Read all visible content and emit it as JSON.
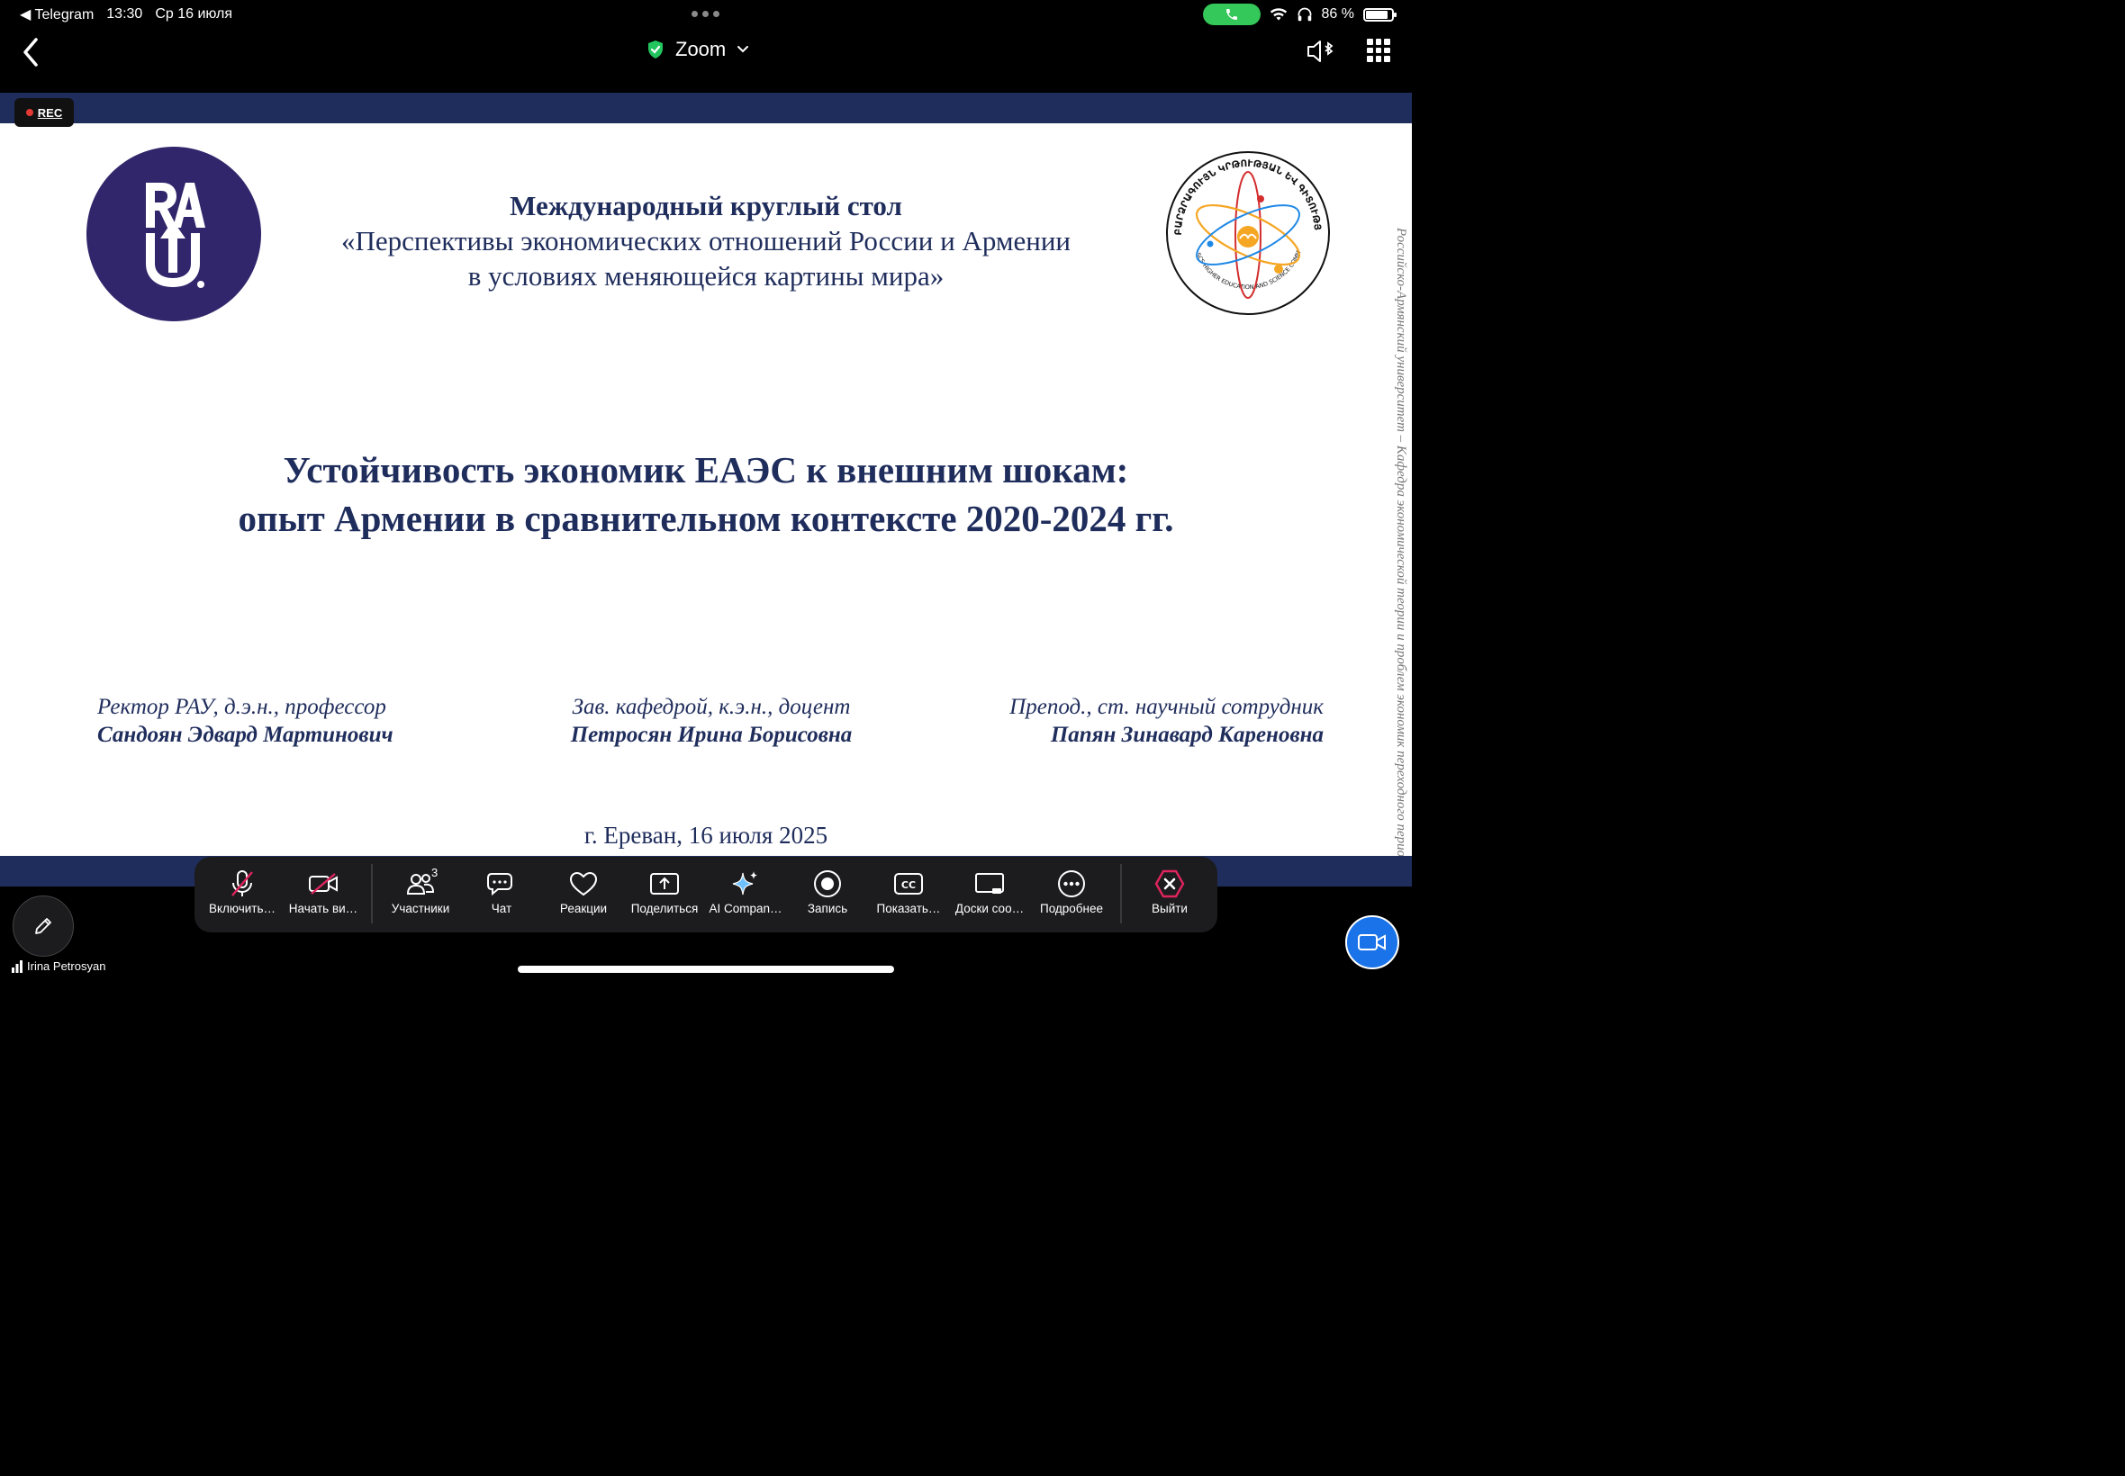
{
  "status_bar": {
    "back_app": "◀ Telegram",
    "time": "13:30",
    "date": "Ср 16 июля",
    "battery_text": "86 %",
    "battery_level": 0.86
  },
  "nav": {
    "title": "Zoom"
  },
  "recording_label": "REC",
  "slide": {
    "header_line1": "Международный круглый стол",
    "header_line2": "«Перспективы экономических отношений России и Армении",
    "header_line3": "в условиях меняющейся картины мира»",
    "title_line1": "Устойчивость экономик ЕАЭС к внешним шокам:",
    "title_line2": "опыт Армении в сравнительном контексте 2020-2024 гг.",
    "people": [
      {
        "role": "Ректор РАУ, д.э.н., профессор",
        "name": "Сандоян Эдвард Мартинович"
      },
      {
        "role": "Зав. кафедрой, к.э.н., доцент",
        "name": "Петросян Ирина Борисовна"
      },
      {
        "role": "Препод., ст. научный сотрудник",
        "name": "Папян Зинавард Кареновна"
      }
    ],
    "city_date": "г. Ереван, 16 июля 2025",
    "side_text": "Российско-Армянский университет – Кафедра экономической теории и проблем экономик переходного периода",
    "logo_left_text": "RAU",
    "logo_right_top": "ՀՀ ԿԳՄՍՆ ԲԱՐՁՐԱԳՈՒՅՆ ԿՐԹՈՒԹՅԱՆ ԵՎ ԳԻՏՈՒԹՅԱՆ ԿՈՄԻՏԵ",
    "logo_right_bottom": "RA MESCS HIGHER EDUCATION AND SCIENCE COMMITTEE"
  },
  "toolbar": {
    "items": [
      {
        "label": "Включить…"
      },
      {
        "label": "Начать ви…"
      },
      {
        "label": "Участники",
        "badge": "3"
      },
      {
        "label": "Чат"
      },
      {
        "label": "Реакции"
      },
      {
        "label": "Поделиться"
      },
      {
        "label": "AI Compan…"
      },
      {
        "label": "Запись"
      },
      {
        "label": "Показать…"
      },
      {
        "label": "Доски соо…"
      },
      {
        "label": "Подробнее"
      },
      {
        "label": "Выйти"
      }
    ]
  },
  "self_name": "Irina Petrosyan",
  "colors": {
    "slide_navy": "#1f2d5c",
    "logo_purple": "#31266b",
    "call_green": "#34c759",
    "leave_red": "#e0245e",
    "fab_blue": "#1a73e8"
  }
}
